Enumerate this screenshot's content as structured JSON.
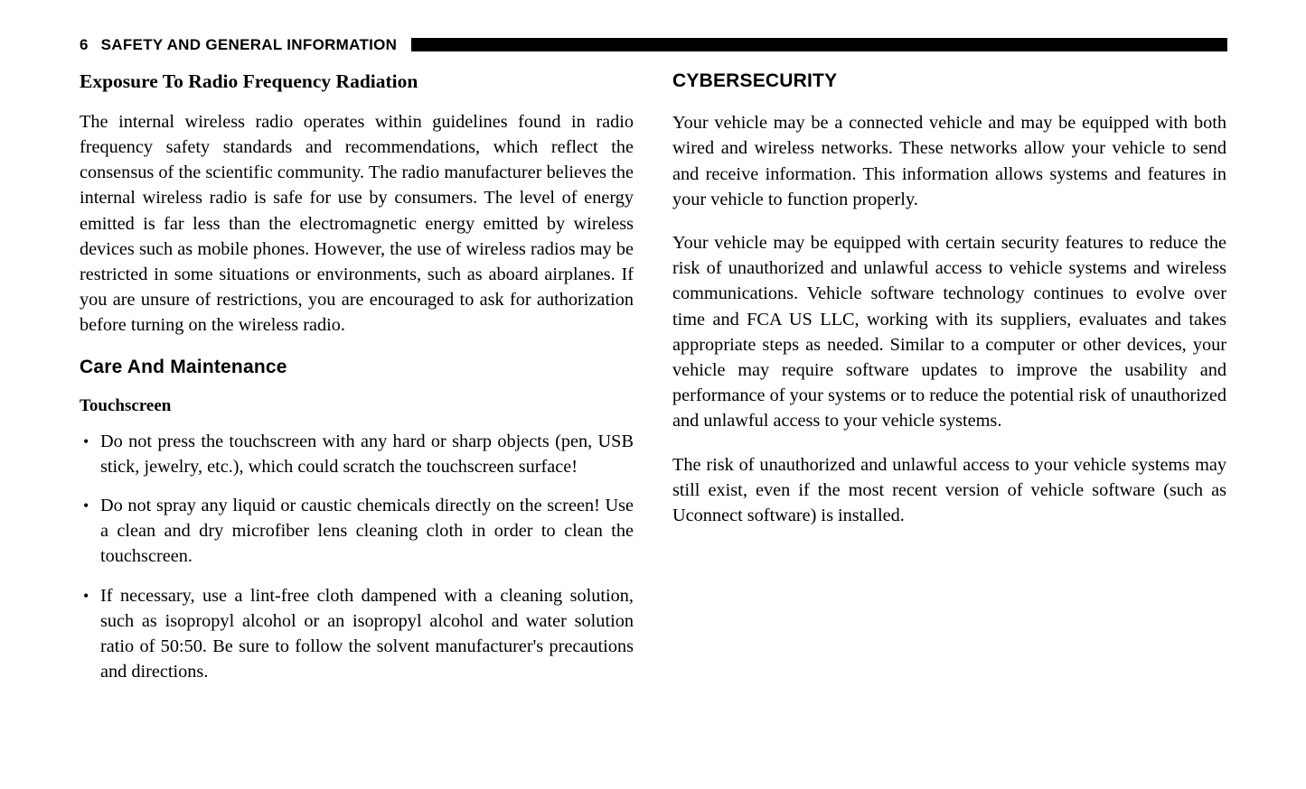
{
  "header": {
    "page_number": "6",
    "title": "SAFETY AND GENERAL INFORMATION",
    "rule_color": "#000000"
  },
  "left_column": {
    "heading_1": "Exposure To Radio Frequency Radiation",
    "paragraph_1": "The internal wireless radio operates within guidelines found in radio frequency safety standards and recommendations, which reflect the consensus of the scientific community. The radio manufacturer believes the internal wireless radio is safe for use by consumers. The level of energy emitted is far less than the electromagnetic energy emitted by wireless devices such as mobile phones. However, the use of wireless radios may be restricted in some situations or environments, such as aboard airplanes. If you are unsure of restrictions, you are encouraged to ask for authorization before turning on the wireless radio.",
    "heading_2": "Care And Maintenance",
    "subheading_1": "Touchscreen",
    "bullets": [
      "Do not press the touchscreen with any hard or sharp objects (pen, USB stick, jewelry, etc.), which could scratch the touchscreen surface!",
      "Do not spray any liquid or caustic chemicals directly on the screen! Use a clean and dry microfiber lens cleaning cloth in order to clean the touchscreen.",
      "If necessary, use a lint-free cloth dampened with a cleaning solution, such as isopropyl alcohol or an isopropyl alcohol and water solution ratio of 50:50. Be sure to follow the solvent manufacturer's precautions and directions."
    ]
  },
  "right_column": {
    "heading_1": "CYBERSECURITY",
    "paragraph_1": "Your vehicle may be a connected vehicle and may be equipped with both wired and wireless networks. These networks allow your vehicle to send and receive information. This information allows systems and features in your vehicle to function properly.",
    "paragraph_2": "Your vehicle may be equipped with certain security features to reduce the risk of unauthorized and unlawful access to vehicle systems and wireless communications. Vehicle software technology continues to evolve over time and FCA US LLC, working with its suppliers, evaluates and takes appropriate steps as needed. Similar to a computer or other devices, your vehicle may require software updates to improve the usability and performance of your systems or to reduce the potential risk of unauthorized and unlawful access to your vehicle systems.",
    "paragraph_3": "The risk of unauthorized and unlawful access to your vehicle systems may still exist, even if the most recent version of vehicle software (such as Uconnect software) is installed."
  }
}
